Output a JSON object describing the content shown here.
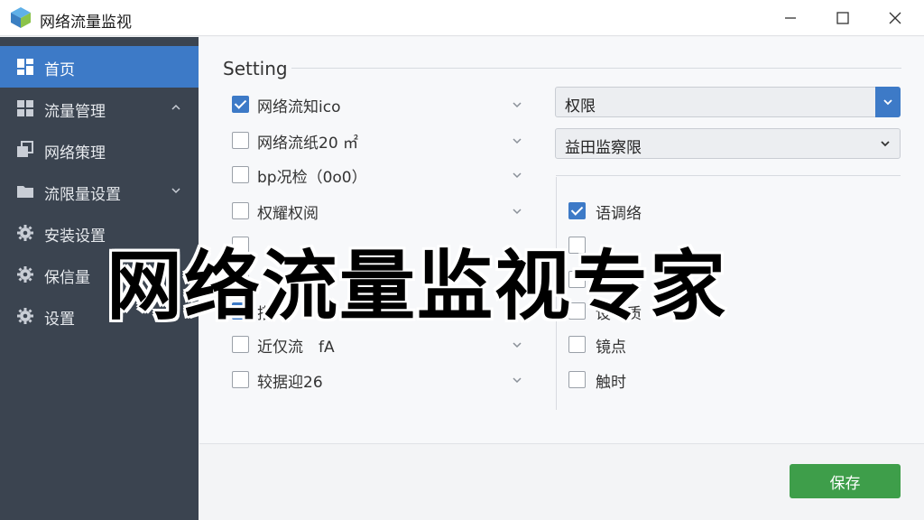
{
  "window": {
    "title": "网络流量监视"
  },
  "sidebar": {
    "items": [
      {
        "label": "首页",
        "icon": "dashboard-icon",
        "active": true
      },
      {
        "label": "流量管理",
        "icon": "grid-icon",
        "expand": "up"
      },
      {
        "label": "网络策理",
        "icon": "copy-icon"
      },
      {
        "label": "流限量设置",
        "icon": "folder-icon",
        "expand": "down"
      },
      {
        "label": "安装设置",
        "icon": "gear-icon"
      },
      {
        "label": "保信量",
        "icon": "gear-icon"
      },
      {
        "label": "设置",
        "icon": "gear-icon"
      }
    ]
  },
  "main": {
    "section_title": "Setting",
    "left_options": [
      {
        "label": "网络流知ico",
        "checked": true
      },
      {
        "label": "网络流纸20 ㎡",
        "checked": false
      },
      {
        "label": "bp况检（0o0）",
        "checked": false
      },
      {
        "label": "权耀权阅",
        "checked": false
      },
      {
        "label": "",
        "checked": false
      },
      {
        "label": "",
        "checked": false
      },
      {
        "label": "搭",
        "checked": true
      },
      {
        "label": "近仅流　fA",
        "checked": false
      },
      {
        "label": "较据迎26",
        "checked": false
      }
    ],
    "select_primary": {
      "value": "权限"
    },
    "select_secondary": {
      "value": "益田监察限"
    },
    "right_options": [
      {
        "label": "语调络",
        "checked": true
      },
      {
        "label": "",
        "checked": false
      },
      {
        "label": "",
        "checked": false
      },
      {
        "label": "设　质",
        "checked": false
      },
      {
        "label": "镜点",
        "checked": false
      },
      {
        "label": "触时",
        "checked": false
      }
    ]
  },
  "footer": {
    "save_label": "保存"
  },
  "overlay": {
    "caption": "网络流量监视专家"
  },
  "colors": {
    "sidebar_bg": "#3b4450",
    "accent": "#3d7ac7",
    "save_button": "#3e9e4a"
  }
}
